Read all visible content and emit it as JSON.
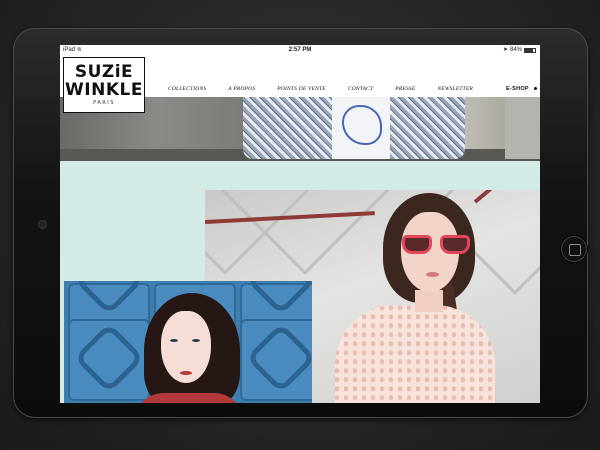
{
  "statusbar": {
    "device": "iPad",
    "time": "2:57 PM",
    "battery": "84%"
  },
  "logo": {
    "line1": "SUZiE",
    "line2": "WINKLE",
    "subline": "PARIS"
  },
  "nav": {
    "items": [
      "COLLECTIONS",
      "A PROPOS",
      "POINTS DE VENTE",
      "CONTACT",
      "PRESSE",
      "NEWSLETTER"
    ],
    "eshop": "E-SHOP"
  },
  "colors": {
    "teal_background": "#d3eae7",
    "sunglasses_frame": "#e3455d",
    "tile_blue": "#4a8bc0"
  }
}
